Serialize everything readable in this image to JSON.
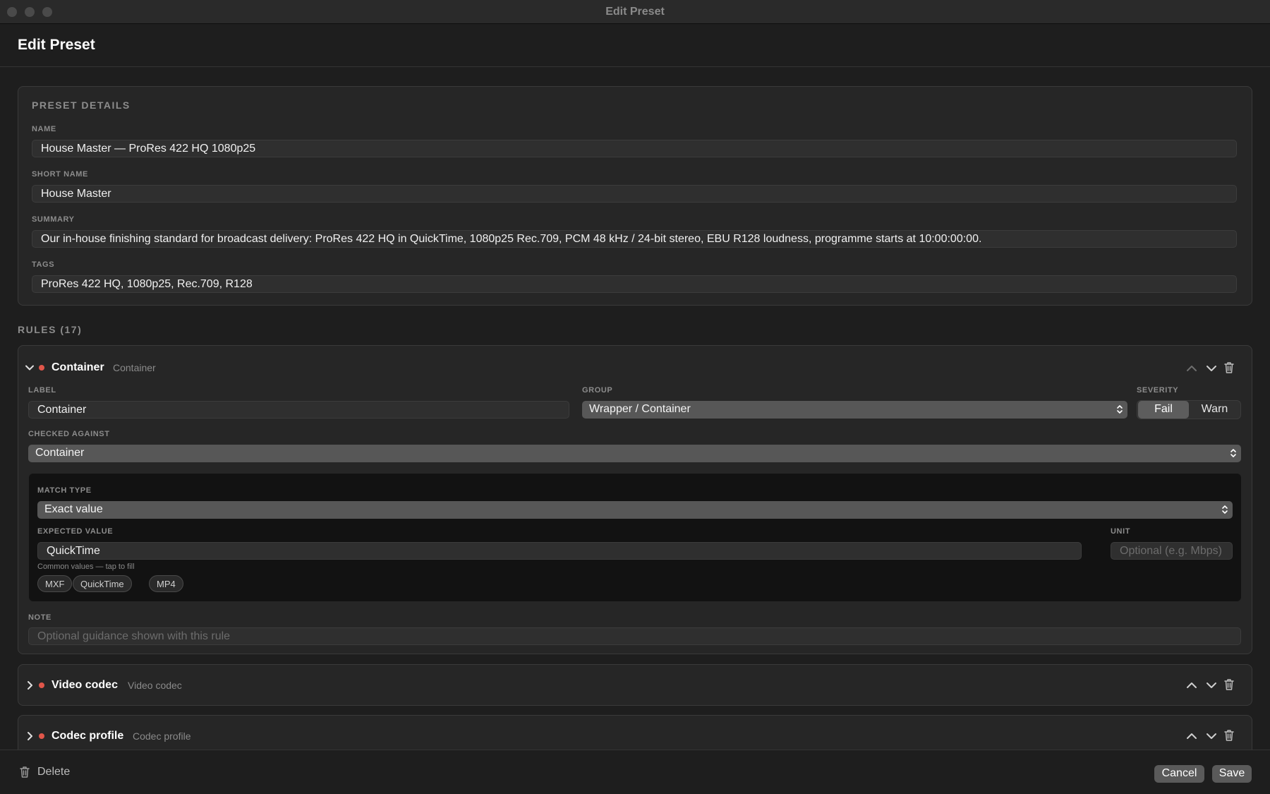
{
  "window": {
    "title": "Edit Preset"
  },
  "header": {
    "title": "Edit Preset"
  },
  "preset_details": {
    "heading": "PRESET DETAILS",
    "name_label": "NAME",
    "name_value": "House Master — ProRes 422 HQ 1080p25",
    "short_name_label": "SHORT NAME",
    "short_name_value": "House Master",
    "summary_label": "SUMMARY",
    "summary_value": "Our in-house finishing standard for broadcast delivery: ProRes 422 HQ in QuickTime, 1080p25 Rec.709, PCM 48 kHz / 24-bit stereo, EBU R128 loudness, programme starts at 10:00:00:00.",
    "tags_label": "TAGS",
    "tags_value": "ProRes 422 HQ, 1080p25, Rec.709, R128"
  },
  "rules": {
    "heading": "RULES (17)",
    "expanded": {
      "title": "Container",
      "subtitle": "Container",
      "label_label": "LABEL",
      "label_value": "Container",
      "group_label": "GROUP",
      "group_value": "Wrapper / Container",
      "severity_label": "SEVERITY",
      "severity_options": [
        "Fail",
        "Warn"
      ],
      "severity_selected": "Fail",
      "checked_against_label": "CHECKED AGAINST",
      "checked_against_value": "Container",
      "match_type_label": "MATCH TYPE",
      "match_type_value": "Exact value",
      "expected_value_label": "EXPECTED VALUE",
      "expected_value": "QuickTime",
      "unit_label": "UNIT",
      "unit_placeholder": "Optional (e.g. Mbps)",
      "common_values_hint": "Common values — tap to fill",
      "common_values": [
        "MXF",
        "QuickTime",
        "MP4"
      ],
      "note_label": "NOTE",
      "note_placeholder": "Optional guidance shown with this rule"
    },
    "collapsed": [
      {
        "title": "Video codec",
        "subtitle": "Video codec"
      },
      {
        "title": "Codec profile",
        "subtitle": "Codec profile"
      }
    ]
  },
  "footer": {
    "delete_label": "Delete",
    "cancel_label": "Cancel",
    "save_label": "Save"
  },
  "colors": {
    "severity_dot": "#e0564a",
    "background": "#1e1e1e",
    "card": "#262626"
  },
  "icons": [
    "chevron-down-icon",
    "chevron-right-icon",
    "chevron-up-icon",
    "trash-icon",
    "updown-icon"
  ]
}
